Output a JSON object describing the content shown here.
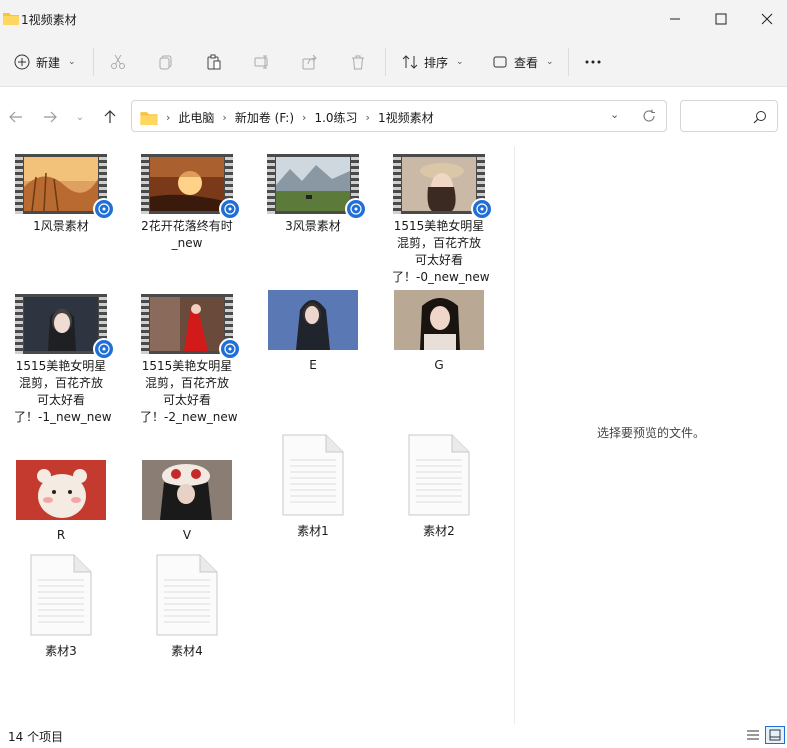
{
  "window": {
    "title": "1视频素材"
  },
  "toolbar": {
    "new_label": "新建",
    "sort_label": "排序",
    "view_label": "查看"
  },
  "address": {
    "crumbs": [
      "此电脑",
      "新加卷 (F:)",
      "1.0练习",
      "1视频素材"
    ]
  },
  "items": [
    {
      "label": "1风景素材",
      "type": "video",
      "theme": "sunset-field"
    },
    {
      "label": "2花开花落终有时_new",
      "type": "video",
      "theme": "sunset-grass"
    },
    {
      "label": "3风景素材",
      "type": "video",
      "theme": "mountains"
    },
    {
      "label": "1515美艳女明星混剪，百花齐放可太好看了！-0_new_new",
      "type": "video",
      "theme": "portrait-hat"
    },
    {
      "label": "1515美艳女明星混剪，百花齐放可太好看了！-1_new_new",
      "type": "video",
      "theme": "portrait-dark"
    },
    {
      "label": "1515美艳女明星混剪，百花齐放可太好看了！-2_new_new",
      "type": "video",
      "theme": "portrait-red"
    },
    {
      "label": "E",
      "type": "image",
      "theme": "blue-portrait"
    },
    {
      "label": "G",
      "type": "image",
      "theme": "beige-portrait"
    },
    {
      "label": "R",
      "type": "image",
      "theme": "red-bear"
    },
    {
      "label": "V",
      "type": "image",
      "theme": "mask-portrait"
    },
    {
      "label": "素材1",
      "type": "doc"
    },
    {
      "label": "素材2",
      "type": "doc"
    },
    {
      "label": "素材3",
      "type": "doc"
    },
    {
      "label": "素材4",
      "type": "doc"
    }
  ],
  "preview": {
    "message": "选择要预览的文件。"
  },
  "status": {
    "count": "14 个项目"
  }
}
